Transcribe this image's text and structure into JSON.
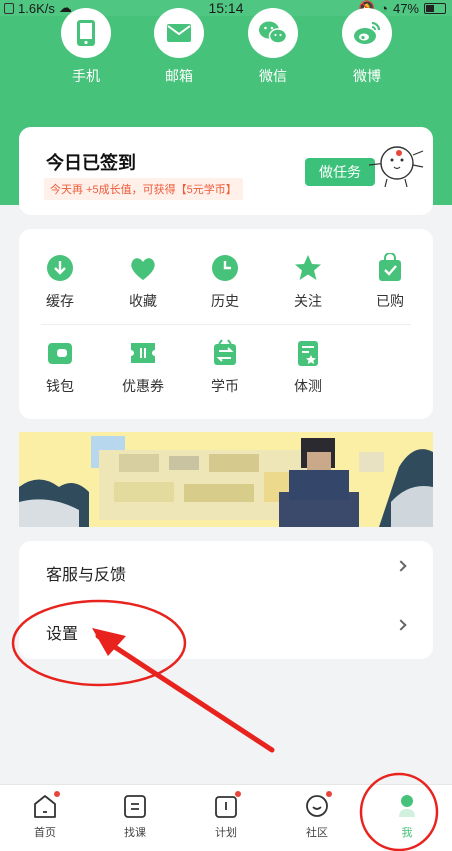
{
  "statusbar": {
    "network_speed": "1.6K/s",
    "time": "15:14",
    "battery": "47%",
    "battery_level": 0.47
  },
  "share": [
    {
      "label": "手机",
      "icon": "phone-icon"
    },
    {
      "label": "邮箱",
      "icon": "mail-icon"
    },
    {
      "label": "微信",
      "icon": "wechat-icon"
    },
    {
      "label": "微博",
      "icon": "weibo-icon"
    }
  ],
  "signin": {
    "title": "今日已签到",
    "subtitle": "今天再 +5成长值，可获得【5元学币】",
    "task_button": "做任务"
  },
  "grid": [
    {
      "label": "缓存",
      "icon": "cloud-download-icon"
    },
    {
      "label": "收藏",
      "icon": "heart-icon"
    },
    {
      "label": "历史",
      "icon": "clock-icon"
    },
    {
      "label": "关注",
      "icon": "star-icon"
    },
    {
      "label": "已购",
      "icon": "bag-check-icon"
    },
    {
      "label": "钱包",
      "icon": "wallet-icon"
    },
    {
      "label": "优惠券",
      "icon": "coupon-icon"
    },
    {
      "label": "学币",
      "icon": "coin-exchange-icon"
    },
    {
      "label": "体测",
      "icon": "test-doc-icon"
    }
  ],
  "menu": [
    {
      "label": "客服与反馈"
    },
    {
      "label": "设置"
    }
  ],
  "tabs": [
    {
      "label": "首页",
      "icon": "home-icon",
      "dot": true
    },
    {
      "label": "找课",
      "icon": "course-icon",
      "dot": false
    },
    {
      "label": "计划",
      "icon": "plan-icon",
      "dot": true
    },
    {
      "label": "社区",
      "icon": "community-icon",
      "dot": true
    },
    {
      "label": "我",
      "icon": "me-icon",
      "dot": false,
      "active": true
    }
  ],
  "colors": {
    "brand_green": "#47c27a",
    "accent_red": "#e9443a",
    "annotation_red": "#e8231d"
  }
}
